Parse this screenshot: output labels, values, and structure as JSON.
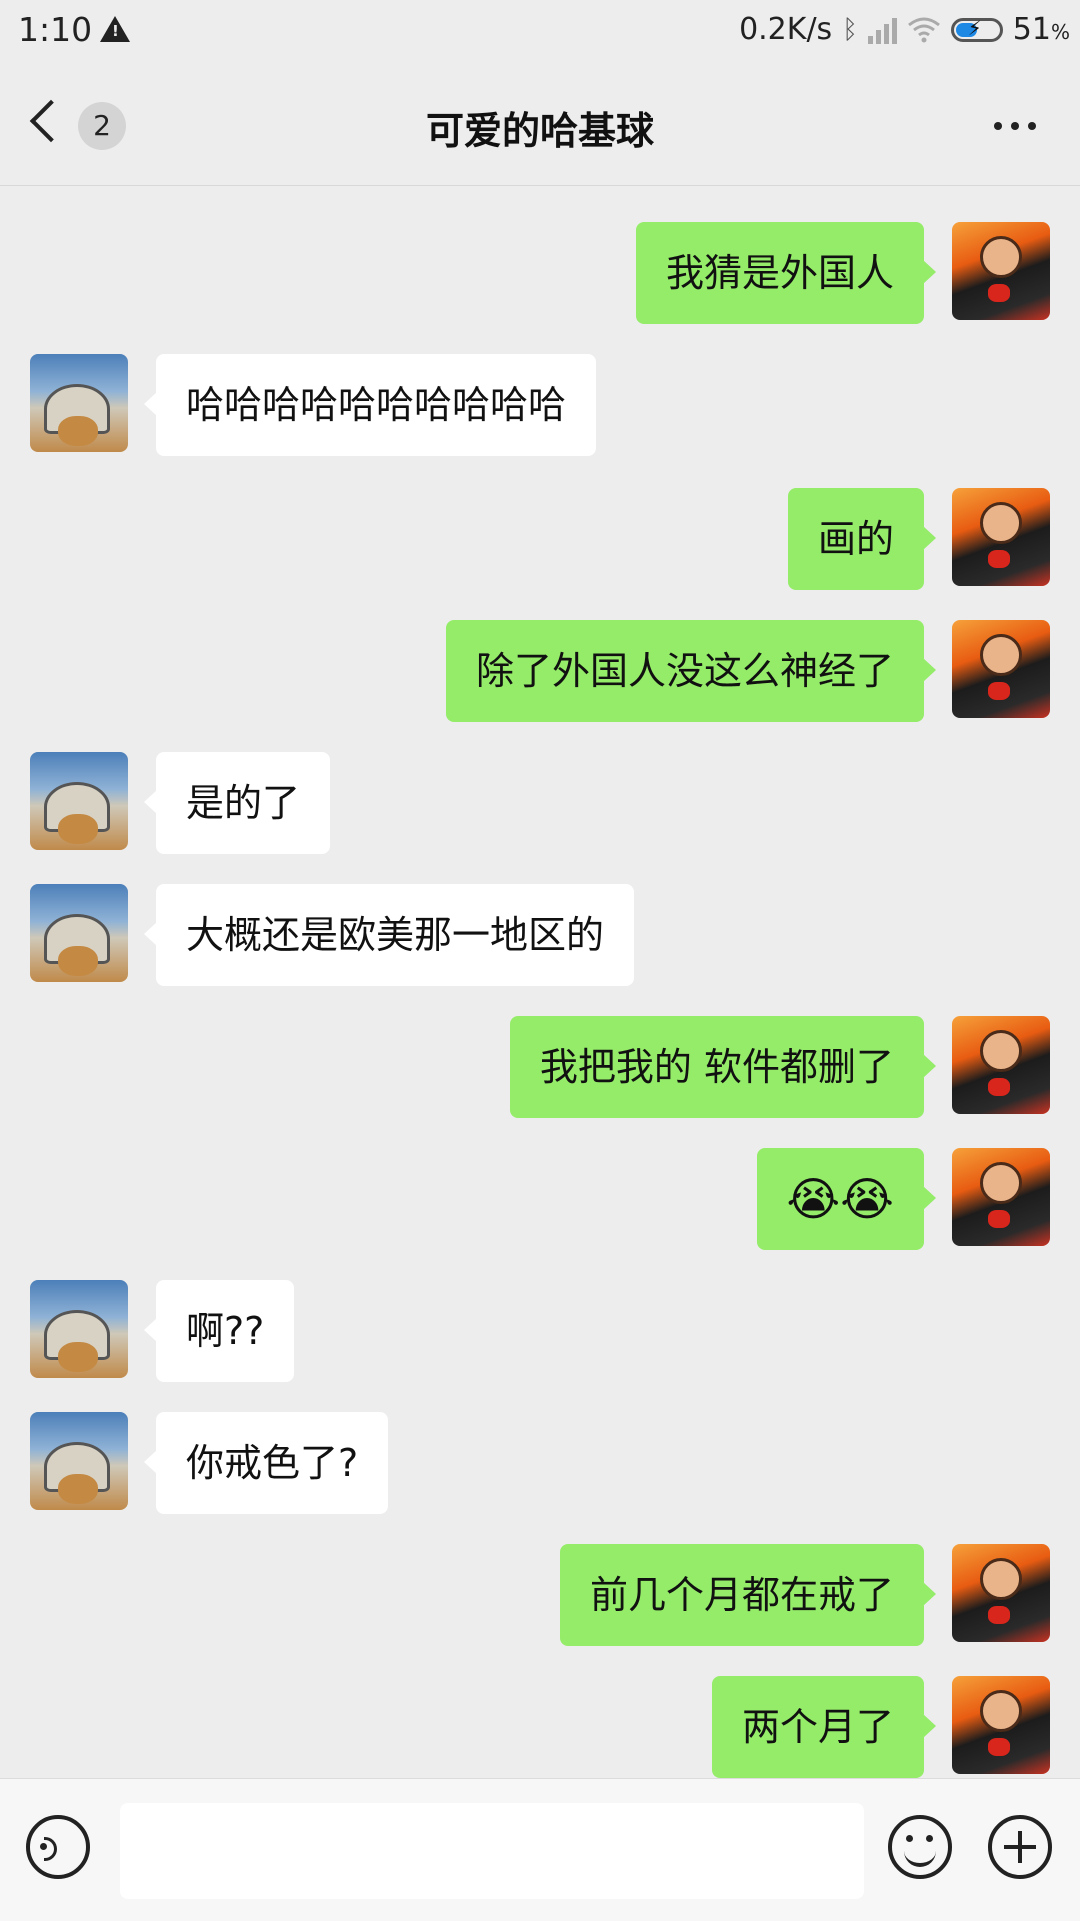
{
  "status_bar": {
    "time": "1:10",
    "net_speed": "0.2K/s",
    "battery_percent": "51",
    "battery_suffix": "%",
    "battery_level": 0.51,
    "icons": [
      "warning-icon",
      "bluetooth-icon",
      "hd-signal-icon",
      "wifi-icon",
      "battery-charging-icon"
    ]
  },
  "nav": {
    "title": "可爱的哈基球",
    "unread_badge": "2"
  },
  "messages": [
    {
      "sender": "me",
      "text": "我猜是外国人"
    },
    {
      "sender": "them",
      "text": "哈哈哈哈哈哈哈哈哈哈"
    },
    {
      "sender": "me",
      "text": "画的"
    },
    {
      "sender": "me",
      "text": "除了外国人没这么神经了"
    },
    {
      "sender": "them",
      "text": "是的了"
    },
    {
      "sender": "them",
      "text": "大概还是欧美那一地区的"
    },
    {
      "sender": "me",
      "text": "我把我的    软件都删了"
    },
    {
      "sender": "me",
      "text": "😭😭"
    },
    {
      "sender": "them",
      "text": "啊??"
    },
    {
      "sender": "them",
      "text": "你戒色了?"
    },
    {
      "sender": "me",
      "text": "前几个月都在戒了"
    },
    {
      "sender": "me",
      "text": "两个月了"
    }
  ],
  "colors": {
    "background": "#ededed",
    "my_bubble": "#95ec69",
    "their_bubble": "#ffffff"
  }
}
